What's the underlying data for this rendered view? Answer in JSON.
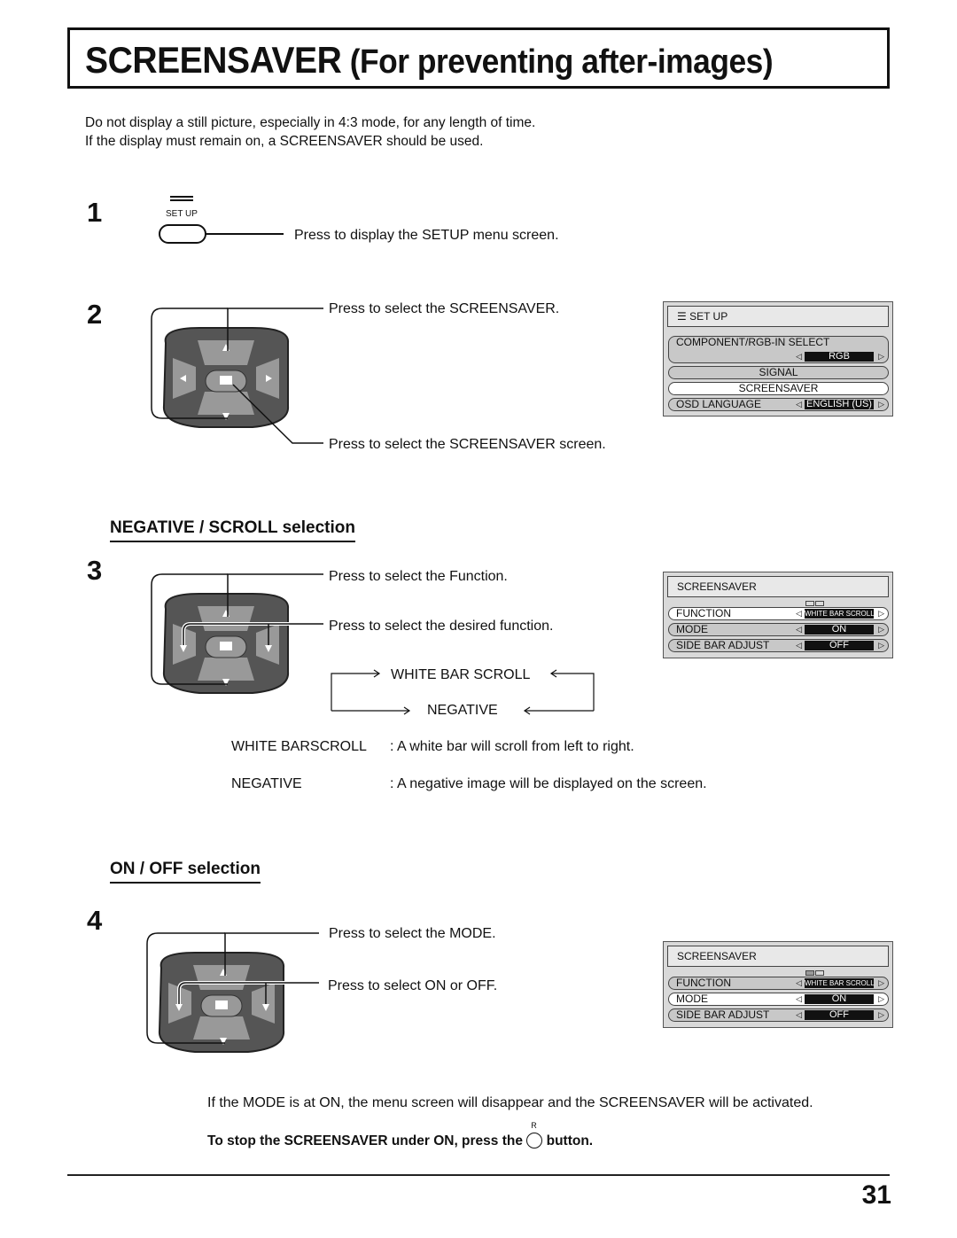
{
  "title": {
    "main": "SCREENSAVER",
    "sub": "(For preventing after-images)"
  },
  "intro": [
    "Do not display a still picture, especially in 4:3 mode, for any length of time.",
    "If the display must remain on, a SCREENSAVER should be used."
  ],
  "step1": {
    "number": "1",
    "button_label": "SET UP",
    "button_icon": "menu-lines-icon",
    "instruction": "Press to display the SETUP menu screen."
  },
  "step2": {
    "number": "2",
    "instruction_up_down": "Press to select the SCREENSAVER.",
    "instruction_center": "Press to select the SCREENSAVER screen.",
    "osd": {
      "title": "SET UP",
      "rows": [
        {
          "label": "COMPONENT/RGB-IN  SELECT",
          "value": "RGB",
          "selected": false
        },
        {
          "label": "SIGNAL",
          "selected": false
        },
        {
          "label": "SCREENSAVER",
          "selected": true
        },
        {
          "label": "OSD  LANGUAGE",
          "value": "ENGLISH (US)",
          "selected": false
        }
      ]
    }
  },
  "section_negative_scroll": {
    "heading": "NEGATIVE / SCROLL selection"
  },
  "step3": {
    "number": "3",
    "instruction_up_down": "Press to select the Function.",
    "instruction_left_right": "Press to select the desired function.",
    "cycle": [
      "WHITE BAR SCROLL",
      "NEGATIVE"
    ],
    "definitions": [
      {
        "term": "WHITE BARSCROLL",
        "desc": ": A white bar will scroll from left to right."
      },
      {
        "term": "NEGATIVE",
        "desc": ": A negative image will be displayed on the screen."
      }
    ],
    "osd": {
      "title": "SCREENSAVER",
      "rows": [
        {
          "label": "FUNCTION",
          "value": "WHITE BAR SCROLL",
          "selected": true
        },
        {
          "label": "MODE",
          "value": "ON",
          "selected": false
        },
        {
          "label": "SIDE BAR ADJUST",
          "value": "OFF",
          "selected": false
        }
      ]
    }
  },
  "section_on_off": {
    "heading": "ON / OFF selection"
  },
  "step4": {
    "number": "4",
    "instruction_up_down": "Press to select the MODE.",
    "instruction_left_right": "Press to select ON or OFF.",
    "osd": {
      "title": "SCREENSAVER",
      "rows": [
        {
          "label": "FUNCTION",
          "value": "WHITE BAR SCROLL",
          "selected": false
        },
        {
          "label": "MODE",
          "value": "ON",
          "selected": true
        },
        {
          "label": "SIDE BAR ADJUST",
          "value": "OFF",
          "selected": false
        }
      ]
    }
  },
  "footer_note": "If the MODE is at ON, the menu screen will disappear and the SCREENSAVER will be activated.",
  "stop_note": {
    "before": "To stop the SCREENSAVER under ON, press the",
    "button_letter": "R",
    "after": "button."
  },
  "page_number": "31"
}
